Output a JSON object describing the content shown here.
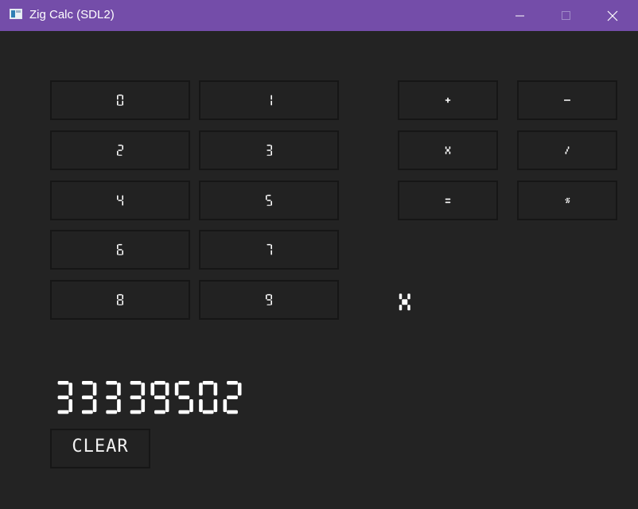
{
  "window": {
    "title": "Zig Calc (SDL2)",
    "controls": [
      "minimize-icon",
      "maximize-icon",
      "close-icon"
    ],
    "accent_color": "#744da9"
  },
  "keypad": {
    "digits": [
      "0",
      "1",
      "2",
      "3",
      "4",
      "5",
      "6",
      "7",
      "8",
      "9"
    ]
  },
  "operators": {
    "add": "+",
    "subtract": "-",
    "multiply": "x",
    "divide": "/",
    "equals": "=",
    "backspace": "«"
  },
  "pending_operator": "x",
  "display": {
    "value": "33339502"
  },
  "clear_label": "CLEAR",
  "colors": {
    "background": "#232323",
    "key_border": "#161616",
    "glyph": "#ffffff"
  }
}
